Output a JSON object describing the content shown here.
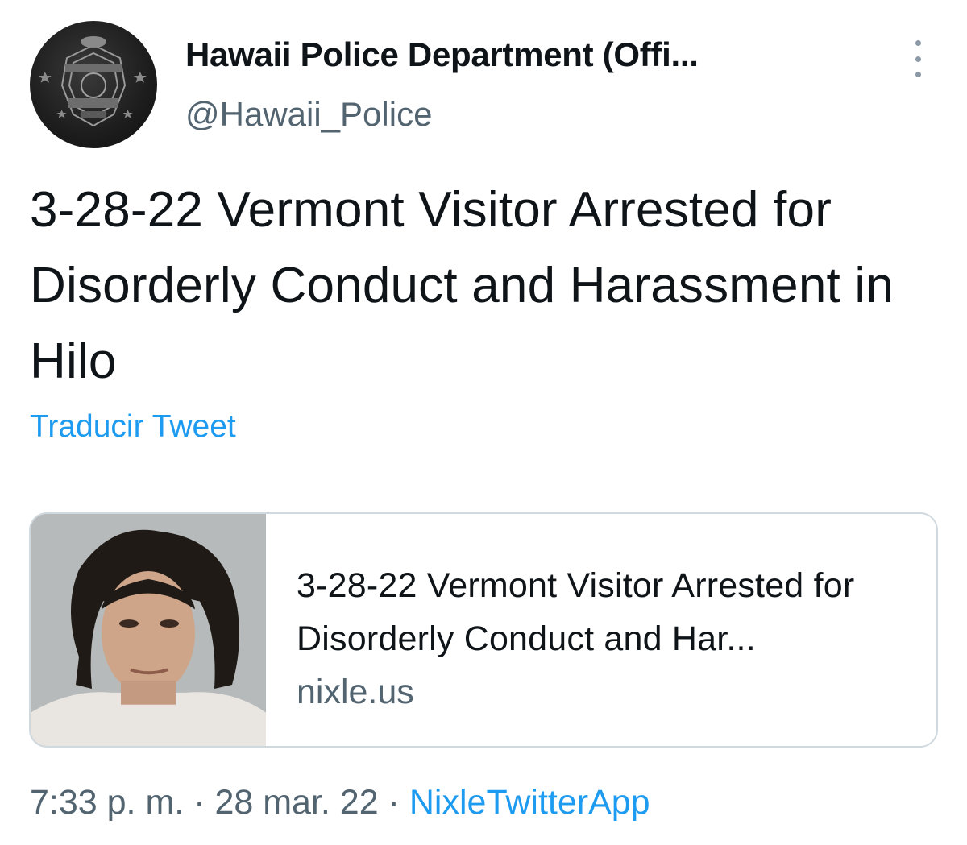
{
  "author": {
    "display_name": "Hawaii Police Department (Offi...",
    "handle": "@Hawaii_Police",
    "avatar_icon": "police-badge-icon"
  },
  "tweet": {
    "text": "3-28-22 Vermont Visitor Arrested for Disorderly Conduct and Harassment in Hilo",
    "translate_label": "Traducir Tweet"
  },
  "card": {
    "title": "3-28-22 Vermont Visitor Arrested for Disorderly Conduct and Har...",
    "domain": "nixle.us",
    "image_icon": "mugshot-photo"
  },
  "meta": {
    "time": "7:33 p. m.",
    "separator": "·",
    "date": "28 mar. 22",
    "source": "NixleTwitterApp"
  },
  "colors": {
    "accent": "#1d9bf0",
    "text": "#0f1419",
    "secondary": "#536471",
    "border": "#cfd9de"
  }
}
